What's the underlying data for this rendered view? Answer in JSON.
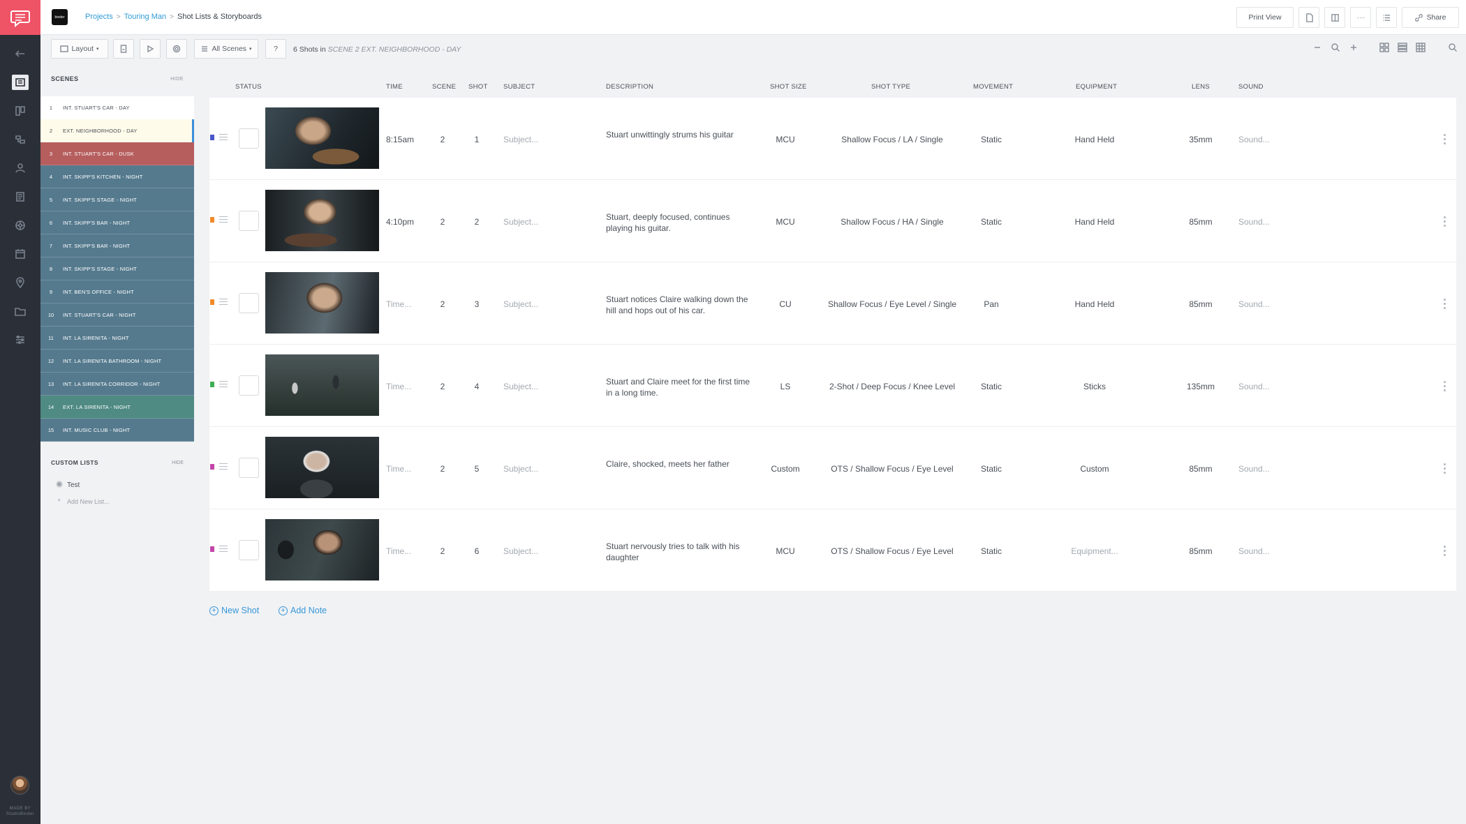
{
  "app": {
    "made_by": "MADE BY\nStudioBinder",
    "logo_text": "binder"
  },
  "breadcrumb": {
    "projects": "Projects",
    "project": "Touring Man",
    "current": "Shot Lists & Storyboards"
  },
  "topbar": {
    "print_view": "Print View",
    "share": "Share"
  },
  "toolbar": {
    "layout": "Layout",
    "all_scenes": "All Scenes",
    "help": "?",
    "shots_count": "6 Shots in",
    "scene_label": "SCENE 2 EXT. NEIGHBORHOOD - DAY"
  },
  "sidebar": {
    "scenes_title": "SCENES",
    "hide": "HIDE",
    "scenes": [
      {
        "num": "1",
        "label": "INT. STUART'S CAR - DAY",
        "kind": "day"
      },
      {
        "num": "2",
        "label": "EXT. NEIGHBORHOOD - DAY",
        "kind": "sel"
      },
      {
        "num": "3",
        "label": "INT. STUART'S CAR - DUSK",
        "kind": "dusk"
      },
      {
        "num": "4",
        "label": "INT. SKIPP'S KITCHEN - NIGHT",
        "kind": "night"
      },
      {
        "num": "5",
        "label": "INT. SKIPP'S STAGE - NIGHT",
        "kind": "night"
      },
      {
        "num": "6",
        "label": "INT. SKIPP'S BAR - NIGHT",
        "kind": "night"
      },
      {
        "num": "7",
        "label": "INT. SKIPP'S BAR - NIGHT",
        "kind": "night"
      },
      {
        "num": "8",
        "label": "INT. SKIPP'S STAGE - NIGHT",
        "kind": "night"
      },
      {
        "num": "9",
        "label": "INT. BEN'S OFFICE - NIGHT",
        "kind": "night"
      },
      {
        "num": "10",
        "label": "INT. STUART'S CAR - NIGHT",
        "kind": "night"
      },
      {
        "num": "11",
        "label": "INT. LA SIRENITA - NIGHT",
        "kind": "night"
      },
      {
        "num": "12",
        "label": "INT. LA SIRENITA BATHROOM - NIGHT",
        "kind": "night"
      },
      {
        "num": "13",
        "label": "INT. LA SIRENITA CORRIDOR - NIGHT",
        "kind": "night"
      },
      {
        "num": "14",
        "label": "EXT. LA SIRENITA - NIGHT",
        "kind": "ext"
      },
      {
        "num": "15",
        "label": "INT. MUSIC CLUB - NIGHT",
        "kind": "night"
      }
    ],
    "custom_lists_title": "CUSTOM LISTS",
    "custom_hide": "HIDE",
    "custom_lists": [
      {
        "label": "Test"
      }
    ],
    "add_new_list": "Add New List..."
  },
  "columns": {
    "status": "STATUS",
    "time": "TIME",
    "scene": "SCENE",
    "shot": "SHOT",
    "subject": "SUBJECT",
    "description": "DESCRIPTION",
    "shot_size": "SHOT SIZE",
    "shot_type": "SHOT TYPE",
    "movement": "MOVEMENT",
    "equipment": "EQUIPMENT",
    "lens": "LENS",
    "sound": "SOUND"
  },
  "shots": [
    {
      "color": "#4a55c9",
      "time": "8:15am",
      "time_set": true,
      "scene": "2",
      "shot": "1",
      "subject": "Subject...",
      "description": "Stuart unwittingly strums his guitar",
      "shot_size": "MCU",
      "shot_type": "Shallow Focus / LA / Single",
      "movement": "Static",
      "equipment": "Hand Held",
      "equipment_set": true,
      "lens": "35mm",
      "sound": "Sound..."
    },
    {
      "color": "#f08a2c",
      "time": "4:10pm",
      "time_set": true,
      "scene": "2",
      "shot": "2",
      "subject": "Subject...",
      "description": "Stuart, deeply focused, continues playing his guitar.",
      "shot_size": "MCU",
      "shot_type": "Shallow Focus / HA / Single",
      "movement": "Static",
      "equipment": "Hand Held",
      "equipment_set": true,
      "lens": "85mm",
      "sound": "Sound..."
    },
    {
      "color": "#f08a2c",
      "time": "Time...",
      "time_set": false,
      "scene": "2",
      "shot": "3",
      "subject": "Subject...",
      "description": "Stuart notices Claire walking down the hill and hops out of his car.",
      "shot_size": "CU",
      "shot_type": "Shallow Focus / Eye Level / Single",
      "movement": "Pan",
      "equipment": "Hand Held",
      "equipment_set": true,
      "lens": "85mm",
      "sound": "Sound..."
    },
    {
      "color": "#3fae54",
      "time": "Time...",
      "time_set": false,
      "scene": "2",
      "shot": "4",
      "subject": "Subject...",
      "description": "Stuart and Claire meet for the first time in a long time.",
      "shot_size": "LS",
      "shot_type": "2-Shot / Deep Focus / Knee Level",
      "movement": "Static",
      "equipment": "Sticks",
      "equipment_set": true,
      "lens": "135mm",
      "sound": "Sound..."
    },
    {
      "color": "#c245a8",
      "time": "Time...",
      "time_set": false,
      "scene": "2",
      "shot": "5",
      "subject": "Subject...",
      "description": "Claire, shocked, meets her father",
      "shot_size": "Custom",
      "shot_type": "OTS / Shallow Focus / Eye Level",
      "movement": "Static",
      "equipment": "Custom",
      "equipment_set": true,
      "lens": "85mm",
      "sound": "Sound..."
    },
    {
      "color": "#c245a8",
      "time": "Time...",
      "time_set": false,
      "scene": "2",
      "shot": "6",
      "subject": "Subject...",
      "description": "Stuart nervously tries to talk with his daughter",
      "shot_size": "MCU",
      "shot_type": "OTS / Shallow Focus / Eye Level",
      "movement": "Static",
      "equipment": "Equipment...",
      "equipment_set": false,
      "lens": "85mm",
      "sound": "Sound..."
    }
  ],
  "actions": {
    "new_shot": "New Shot",
    "add_note": "Add Note"
  }
}
